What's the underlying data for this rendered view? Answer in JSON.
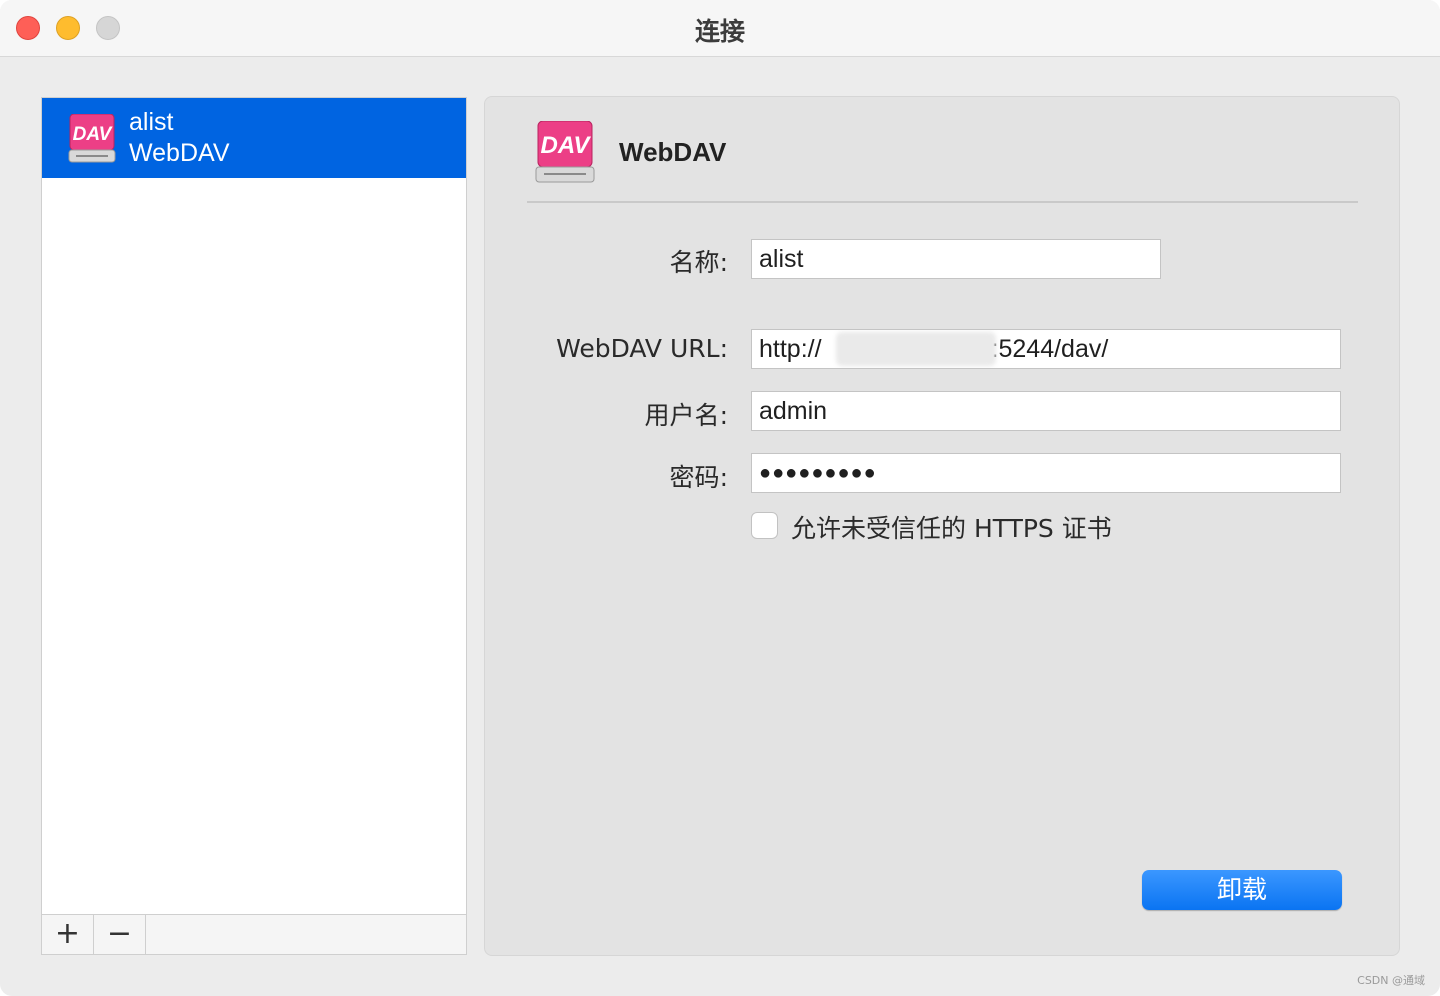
{
  "window": {
    "title": "连接"
  },
  "sidebar": {
    "items": [
      {
        "name": "alist",
        "type": "WebDAV",
        "icon": "webdav-drive-icon",
        "selected": true
      }
    ],
    "toolbar": {
      "add_label": "+",
      "remove_label": "−"
    }
  },
  "detail": {
    "icon": "webdav-drive-icon",
    "header_title": "WebDAV",
    "fields": {
      "name": {
        "label": "名称",
        "value": "alist"
      },
      "url": {
        "label": "WebDAV URL",
        "value_prefix": "http://",
        "value_suffix": ":5244/dav/"
      },
      "username": {
        "label": "用户名",
        "value": "admin"
      },
      "password": {
        "label": "密码",
        "masked_value": "●●●●●●●●●"
      }
    },
    "label_suffix": ":",
    "allow_untrusted_https": {
      "label": "允许未受信任的 HTTPS 证书",
      "checked": false
    },
    "unmount_button": "卸载"
  },
  "watermark": "CSDN @通域",
  "colors": {
    "selection": "#0064e1",
    "primary_button": "#0a74f2",
    "dav_icon_pink": "#ec3f86"
  }
}
